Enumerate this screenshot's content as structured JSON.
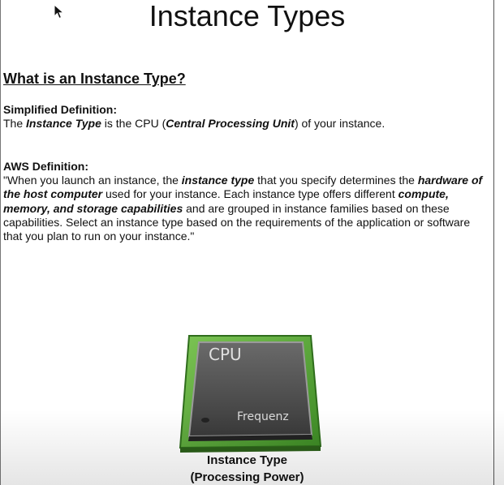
{
  "page": {
    "title": "Instance Types",
    "section_heading": "What is an Instance Type?",
    "simplified": {
      "label": "Simplified Definition:",
      "t1": "The ",
      "t2": "Instance Type",
      "t3": " is the CPU (",
      "t4": "Central Processing Unit",
      "t5": ") of your instance."
    },
    "aws": {
      "label": "AWS Definition:",
      "t1": "\"When you launch an instance, the ",
      "t2": "instance type",
      "t3": " that you specify determines the ",
      "t4": "hardware of the host computer",
      "t5": " used for your instance. Each instance type offers different ",
      "t6": "compute, memory, and storage capabilities",
      "t7": " and are grouped in instance families based on these capabilities. Select an instance type based on the requirements of the application or software that you plan to run on your instance.\""
    },
    "chip": {
      "icon": "cpu-chip-icon",
      "label_top": "CPU",
      "label_bottom": "Frequenz"
    },
    "caption": {
      "line1": "Instance Type",
      "line2": "(Processing Power)"
    }
  },
  "colors": {
    "chip_green": "#5aa83a",
    "chip_body": "#4a4a4a",
    "chip_text": "#e0e0e0"
  }
}
